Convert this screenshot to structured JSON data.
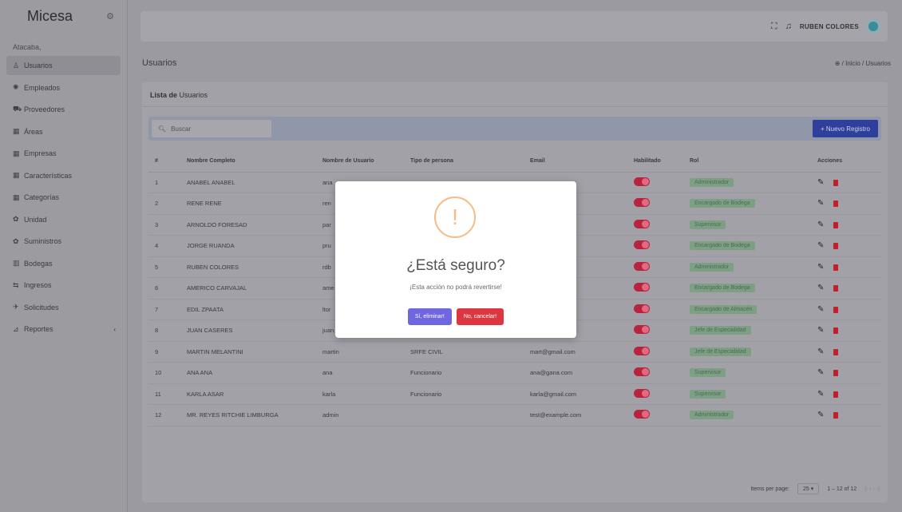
{
  "sidebar": {
    "brand": "Micesa",
    "subtitle": "Atacaba,",
    "items": [
      {
        "label": "Usuarios",
        "icon": "user-icon",
        "glyph": "♙",
        "active": true
      },
      {
        "label": "Empleados",
        "icon": "group-icon",
        "glyph": "✺"
      },
      {
        "label": "Proveedores",
        "icon": "truck-icon",
        "glyph": "⛟"
      },
      {
        "label": "Áreas",
        "icon": "grid-icon",
        "glyph": "▦"
      },
      {
        "label": "Empresas",
        "icon": "building-icon",
        "glyph": "▦"
      },
      {
        "label": "Características",
        "icon": "list-icon",
        "glyph": "▦"
      },
      {
        "label": "Categorías",
        "icon": "tag-icon",
        "glyph": "▦"
      },
      {
        "label": "Unidad",
        "icon": "ruler-icon",
        "glyph": "✿"
      },
      {
        "label": "Suministros",
        "icon": "box-icon",
        "glyph": "✿"
      },
      {
        "label": "Bodegas",
        "icon": "warehouse-icon",
        "glyph": "▥"
      },
      {
        "label": "Ingresos",
        "icon": "inbox-icon",
        "glyph": "⇆"
      },
      {
        "label": "Solicitudes",
        "icon": "send-icon",
        "glyph": "✈"
      },
      {
        "label": "Reportes",
        "icon": "chart-icon",
        "glyph": "⊿",
        "caret": "‹"
      }
    ]
  },
  "topbar": {
    "username": "RUBEN COLORES",
    "expand_icon": "⛶",
    "bell_icon": "♫"
  },
  "page": {
    "title": "Usuarios",
    "breadcrumb": "⊕ / Inicio / Usuarios"
  },
  "card": {
    "title_bold": "Lista de",
    "title_rest": "Usuarios",
    "search_placeholder": "Buscar",
    "new_button": "+ Nuevo Registro"
  },
  "table": {
    "headers": [
      "#",
      "Nombre Completo",
      "Nombre de Usuario",
      "Tipo de persona",
      "Email",
      "Habilitado",
      "Rol",
      "Acciones"
    ],
    "rows": [
      {
        "n": "1",
        "name": "ANABEL ANABEL",
        "user": "ana",
        "type": "",
        "email": "…m",
        "role": "Administrador"
      },
      {
        "n": "2",
        "name": "RENE RENE",
        "user": "ren",
        "type": "",
        "email": "…m",
        "role": "Encargado de Bodega"
      },
      {
        "n": "3",
        "name": "ARNOLDO FORESAD",
        "user": "par",
        "type": "",
        "email": "…m",
        "role": "Supervisor"
      },
      {
        "n": "4",
        "name": "JORGE RUANDA",
        "user": "pru",
        "type": "",
        "email": "….com",
        "role": "Encargado de Bodega"
      },
      {
        "n": "5",
        "name": "RUBEN COLORES",
        "user": "rdb",
        "type": "",
        "email": "….com",
        "role": "Administrador"
      },
      {
        "n": "6",
        "name": "AMERICO CARVAJAL",
        "user": "ame",
        "type": "",
        "email": "….com",
        "role": "Encargado de Bodega"
      },
      {
        "n": "7",
        "name": "EDIL ZPAATA",
        "user": "ltor",
        "type": "",
        "email": "….com",
        "role": "Encargado de Almacén"
      },
      {
        "n": "8",
        "name": "JUAN CASERES",
        "user": "juan",
        "type": "SRFE ELECTRICO",
        "email": "juan@gmail.com",
        "role": "Jefe de Especialidad"
      },
      {
        "n": "9",
        "name": "MARTIN MELANTINI",
        "user": "martin",
        "type": "SRFE CIVIL",
        "email": "mart@gmail.com",
        "role": "Jefe de Especialidad"
      },
      {
        "n": "10",
        "name": "ANA ANA",
        "user": "ana",
        "type": "Funcionario",
        "email": "ana@gana.com",
        "role": "Supervisor"
      },
      {
        "n": "11",
        "name": "KARLA ASAR",
        "user": "karla",
        "type": "Funcionario",
        "email": "karla@gmail.com",
        "role": "Supervisor"
      },
      {
        "n": "12",
        "name": "MR. REYES RITCHIE LIMBURGA",
        "user": "admin",
        "type": "",
        "email": "test@example.com",
        "role": "Administrador"
      }
    ]
  },
  "pager": {
    "label": "Items per page:",
    "value": "25",
    "range": "1 – 12 of 12",
    "nav": "|‹   ‹   ›   ›|"
  },
  "modal": {
    "icon": "!",
    "title": "¿Está seguro?",
    "text": "¡Esta acción no podrá revertirse!",
    "confirm": "Sí, eliminar!",
    "cancel": "No, cancelar!"
  }
}
